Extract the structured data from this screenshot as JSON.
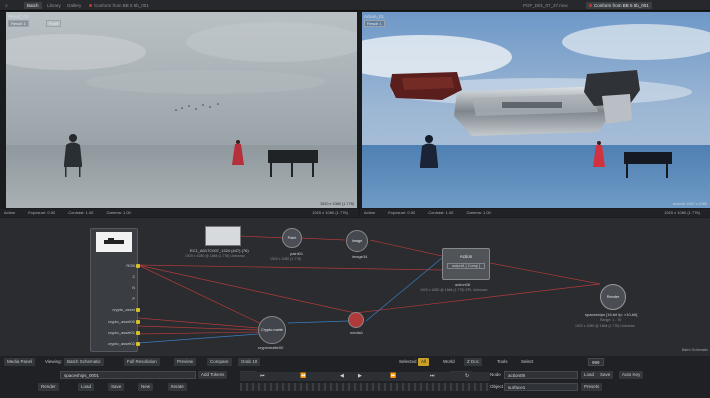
{
  "topbar": {
    "tabs": [
      {
        "label": "Batch"
      },
      {
        "label": "Library"
      },
      {
        "label": "Gallery"
      },
      {
        "label": "Conform from BB 5 5b_001"
      }
    ],
    "right_tabs": [
      {
        "label": "POF_D01_07_27.mov"
      },
      {
        "label": "Conform from BB 5 5b_001"
      }
    ]
  },
  "viewers": {
    "left": {
      "title": "Result_01",
      "tag": "Result 1",
      "tag2": "Front",
      "info": "1920 x 1080 (1.778)",
      "status": [
        "Action",
        "Exposure: 0.00",
        "Contrast: 1.00",
        "Gamma: 1.00"
      ],
      "status_right": "1920 x 1080 (1.778)"
    },
    "right": {
      "title": "Action_01",
      "tag": "Result 1",
      "info": "action8 1920 x 1080",
      "status": [
        "Action",
        "Exposure: 0.00",
        "Contrast: 1.00",
        "Gamma: 1.00"
      ],
      "status_right": "1920 x 1080 (1.778)"
    }
  },
  "schematic": {
    "source_node": {
      "ports": [
        "RGB",
        "Z",
        "N",
        "P",
        "crypto_asset",
        "crypto_asset00",
        "crypto_asset01",
        "crypto_asset02"
      ]
    },
    "nodes": [
      {
        "label": "EC1_A017C007_1324 (#47) (76)",
        "sub": "1920 x 1080 @ 16bit (1.778) Unknown"
      },
      {
        "label": "paint01",
        "sub": "1920 x 1080 (1.778)"
      },
      {
        "label": "Image",
        "sub": "image34"
      },
      {
        "label": "Action",
        "sub": "output1 [ Comp ]"
      },
      {
        "label": "action08",
        "sub": "1920 x 1080 @ 16bit (1.778) SPL Unknown"
      },
      {
        "label": "Crypto matte",
        "sub": "cryptomatte00"
      },
      {
        "label": "media1",
        "sub": ""
      },
      {
        "label": "Render",
        "sub": "spaceships [16-bit fp: >10-bit]"
      },
      {
        "label": "Range: 1 - 76",
        "sub": "1920 x 1080 @ 16bit (1.778) Unknown"
      }
    ],
    "corner_label": "Batch Schematic"
  },
  "bottombar": {
    "row1": {
      "media_panel": "Media Panel",
      "viewing_label": "Viewing:",
      "viewing_value": "Batch Schematic",
      "full_res": "Full Resolution",
      "preview": "Preview",
      "compare": "Compare",
      "grab": "Grab 10",
      "selected": "Selected",
      "all": "All",
      "world": "World",
      "z_doc": "Z Doc",
      "tools": "Tools",
      "select": "Select",
      "zoom": "999"
    },
    "row2": {
      "name_field": "spaceships_0001",
      "add_tokens": "Add Tokens",
      "frame": "SF: 1",
      "options": "Options",
      "node_label": "Node",
      "node_value": "action08",
      "load": "Load",
      "save": "Save",
      "auto_key": "Auto Key"
    },
    "row3": {
      "render": "Render",
      "load": "Load",
      "save": "Save",
      "new": "New",
      "iterate": "Iterate",
      "frame_value": "76",
      "object_label": "Object",
      "object_value": "surface1",
      "presets": "Presets"
    }
  }
}
